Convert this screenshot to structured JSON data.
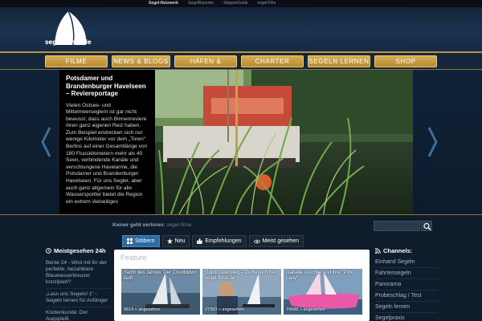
{
  "network": {
    "title": "Segel-Netzwerk",
    "links": [
      "SegelReporter",
      "SkipperGuide",
      "segel:Film"
    ]
  },
  "logo": {
    "text": "segel-filme.de"
  },
  "nav": [
    {
      "label": "FILME"
    },
    {
      "label": "NEWS & BLOGS"
    },
    {
      "label": "HÄFEN & ANKERN"
    },
    {
      "label": "CHARTER"
    },
    {
      "label": "SEGELN LERNEN"
    },
    {
      "label": "SHOP"
    }
  ],
  "slide": {
    "title": "Potsdamer und Brandenburger Havelseen – Reviereportage",
    "body": "Vielen Ostsee- und Mittelmeerseglern ist gar nicht bewusst, dass auch Binnenreviere ihren ganz eigenen Reiz haben. Zum Beispiel erstrecken sich nur wenige Kilometer vor dem „Toren“ Berlins auf einer Gesamtlänge von 180 Flusskilometern mehr als 40 Seen, verbindende Kanäle und verschlungene Havelarme, die Potsdamer und Brandenburger Havelseen. Für uns Segler, aber auch ganz allgemein für alle Wassersportler bietet die Region ein extrem vielseitiges"
  },
  "breadcrumb": {
    "prefix": "Keiner geht verloren:",
    "current": "segel-filme"
  },
  "search": {
    "placeholder": ""
  },
  "tabs": [
    {
      "label": "Stöbern",
      "icon": "grid-icon",
      "active": true
    },
    {
      "label": "Neu",
      "icon": "star-icon",
      "active": false
    },
    {
      "label": "Empfehlungen",
      "icon": "thumbs-up-icon",
      "active": false
    },
    {
      "label": "Meist gesehen",
      "icon": "eye-icon",
      "active": false
    }
  ],
  "left_sidebar": {
    "title": "Meistgesehen 24h",
    "items": [
      "Bente 24 - Wird mit ihr der perfekte, bezahlbare Blauwasserkreuzer konzipiert?",
      "„Lass uns Segeln! 1“ - Segeln lernen für Anfänger",
      "Knotenkunde: Der Augspleiß"
    ]
  },
  "feature": {
    "title": "Feature",
    "cards": [
      {
        "title": "Yacht des Jahres: Der Countdown läuft",
        "views": "5614 » angesehen"
      },
      {
        "title": "Guido Dwersteg – Zu Besuch bei segel-filme.de",
        "views": "27393 » angesehen"
      },
      {
        "title": "Isabelle Joschke und ihre \"Pink Lady\"",
        "views": "74588 » angesehen"
      }
    ]
  },
  "right_sidebar": {
    "title": "Channels:",
    "items": [
      "Einhand Segeln",
      "Fahrtensegeln",
      "Panorama",
      "Probeschlag / Test",
      "Segeln lernen",
      "Segelpraxis"
    ]
  },
  "colors": {
    "nav_gold": "#c99a42",
    "tab_active": "#2f6a9e",
    "background": "#0d1a2a"
  }
}
